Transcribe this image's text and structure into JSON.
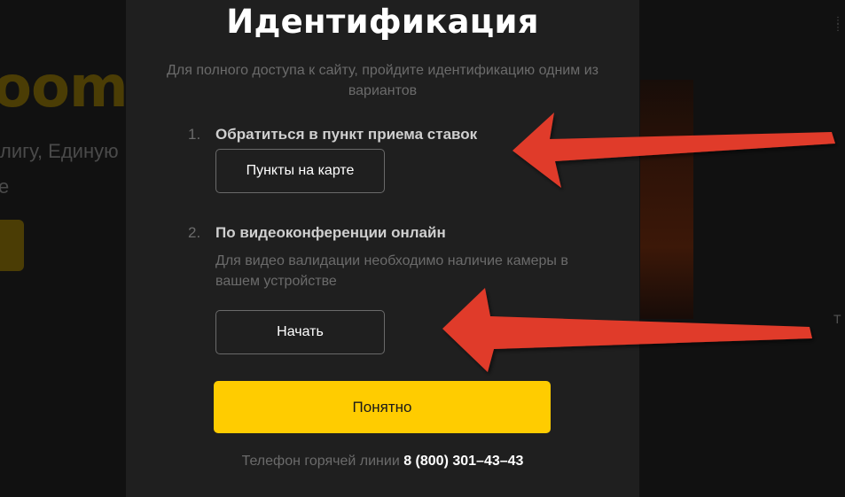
{
  "background": {
    "logo_fragment": "oom",
    "subtitle_fragment": "лигу, Единую",
    "line2_fragment": "е",
    "right_fragment": "Т"
  },
  "modal": {
    "title": "Идентификация",
    "subtitle": "Для полного доступа к сайту, пройдите идентификацию одним из вариантов",
    "steps": [
      {
        "number": "1.",
        "title": "Обратиться в пункт приема ставок",
        "button": "Пункты на карте"
      },
      {
        "number": "2.",
        "title": "По видеоконференции онлайн",
        "description": "Для видео валидации необходимо наличие камеры в вашем устройстве",
        "button": "Начать"
      }
    ],
    "confirm_button": "Понятно",
    "hotline_label": "Телефон горячей линии",
    "hotline_phone": "8 (800) 301–43–43"
  },
  "colors": {
    "accent_yellow": "#ffcc00",
    "arrow_red": "#e03a2b",
    "modal_bg": "#1f1f1f"
  }
}
